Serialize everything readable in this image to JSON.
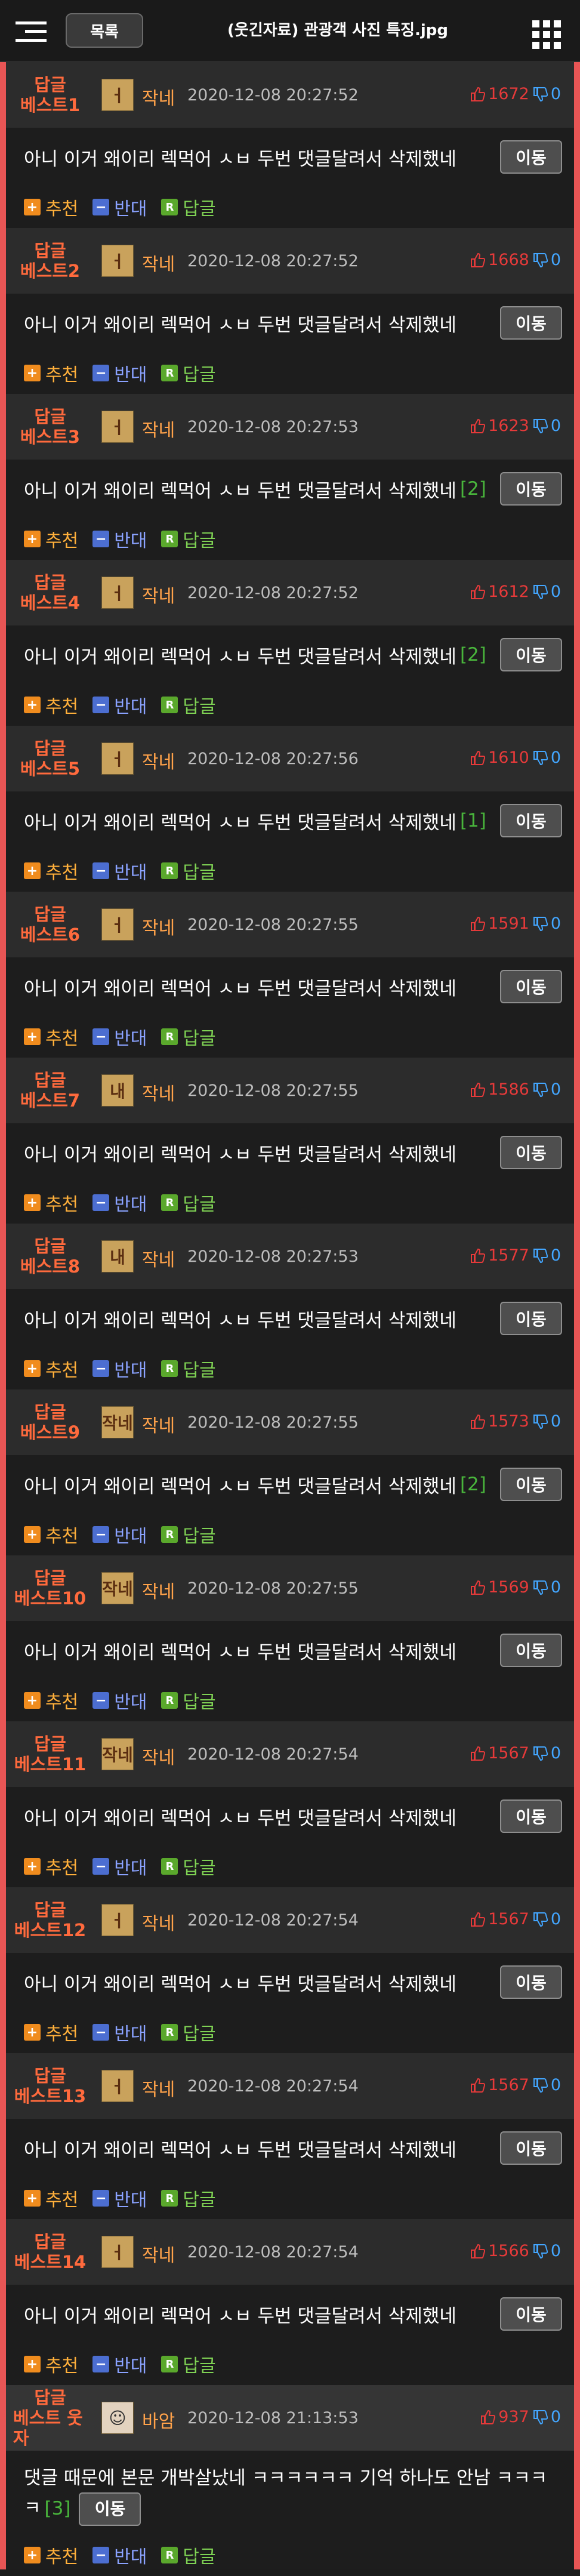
{
  "header": {
    "list_button": "목록",
    "title": "(웃긴자료) 관광객 사진 특징.jpg"
  },
  "comments": [
    {
      "rank_top": "답글",
      "rank_bottom": "베스트1",
      "avatar_text": "ㅓ",
      "nick": "작네",
      "date": "2020-12-08 20:27:52",
      "up": "1672",
      "down": "0",
      "body": "아니 이거 왜이리 렉먹어 ㅅㅂ 두번 댓글달려서 삭제했네",
      "count": "",
      "move": "이동",
      "recommend": "추천",
      "oppose": "반대",
      "reply": "답글"
    },
    {
      "rank_top": "답글",
      "rank_bottom": "베스트2",
      "avatar_text": "ㅓ",
      "nick": "작네",
      "date": "2020-12-08 20:27:52",
      "up": "1668",
      "down": "0",
      "body": "아니 이거 왜이리 렉먹어 ㅅㅂ 두번 댓글달려서 삭제했네",
      "count": "",
      "move": "이동",
      "recommend": "추천",
      "oppose": "반대",
      "reply": "답글"
    },
    {
      "rank_top": "답글",
      "rank_bottom": "베스트3",
      "avatar_text": "ㅓ",
      "nick": "작네",
      "date": "2020-12-08 20:27:53",
      "up": "1623",
      "down": "0",
      "body": "아니 이거 왜이리 렉먹어 ㅅㅂ 두번 댓글달려서 삭제했네",
      "count": "[2]",
      "move": "이동",
      "recommend": "추천",
      "oppose": "반대",
      "reply": "답글"
    },
    {
      "rank_top": "답글",
      "rank_bottom": "베스트4",
      "avatar_text": "ㅓ",
      "nick": "작네",
      "date": "2020-12-08 20:27:52",
      "up": "1612",
      "down": "0",
      "body": "아니 이거 왜이리 렉먹어 ㅅㅂ 두번 댓글달려서 삭제했네",
      "count": "[2]",
      "move": "이동",
      "recommend": "추천",
      "oppose": "반대",
      "reply": "답글"
    },
    {
      "rank_top": "답글",
      "rank_bottom": "베스트5",
      "avatar_text": "ㅓ",
      "nick": "작네",
      "date": "2020-12-08 20:27:56",
      "up": "1610",
      "down": "0",
      "body": "아니 이거 왜이리 렉먹어 ㅅㅂ 두번 댓글달려서 삭제했네",
      "count": "[1]",
      "move": "이동",
      "recommend": "추천",
      "oppose": "반대",
      "reply": "답글"
    },
    {
      "rank_top": "답글",
      "rank_bottom": "베스트6",
      "avatar_text": "ㅓ",
      "nick": "작네",
      "date": "2020-12-08 20:27:55",
      "up": "1591",
      "down": "0",
      "body": "아니 이거 왜이리 렉먹어 ㅅㅂ 두번 댓글달려서 삭제했네",
      "count": "",
      "move": "이동",
      "recommend": "추천",
      "oppose": "반대",
      "reply": "답글"
    },
    {
      "rank_top": "답글",
      "rank_bottom": "베스트7",
      "avatar_text": "내",
      "nick": "작네",
      "date": "2020-12-08 20:27:55",
      "up": "1586",
      "down": "0",
      "body": "아니 이거 왜이리 렉먹어 ㅅㅂ 두번 댓글달려서 삭제했네",
      "count": "",
      "move": "이동",
      "recommend": "추천",
      "oppose": "반대",
      "reply": "답글"
    },
    {
      "rank_top": "답글",
      "rank_bottom": "베스트8",
      "avatar_text": "내",
      "nick": "작네",
      "date": "2020-12-08 20:27:53",
      "up": "1577",
      "down": "0",
      "body": "아니 이거 왜이리 렉먹어 ㅅㅂ 두번 댓글달려서 삭제했네",
      "count": "",
      "move": "이동",
      "recommend": "추천",
      "oppose": "반대",
      "reply": "답글"
    },
    {
      "rank_top": "답글",
      "rank_bottom": "베스트9",
      "avatar_text": "작네",
      "nick": "작네",
      "date": "2020-12-08 20:27:55",
      "up": "1573",
      "down": "0",
      "body": "아니 이거 왜이리 렉먹어 ㅅㅂ 두번 댓글달려서 삭제했네",
      "count": "[2]",
      "move": "이동",
      "recommend": "추천",
      "oppose": "반대",
      "reply": "답글"
    },
    {
      "rank_top": "답글",
      "rank_bottom": "베스트10",
      "avatar_text": "작네",
      "nick": "작네",
      "date": "2020-12-08 20:27:55",
      "up": "1569",
      "down": "0",
      "body": "아니 이거 왜이리 렉먹어 ㅅㅂ 두번 댓글달려서 삭제했네",
      "count": "",
      "move": "이동",
      "recommend": "추천",
      "oppose": "반대",
      "reply": "답글"
    },
    {
      "rank_top": "답글",
      "rank_bottom": "베스트11",
      "avatar_text": "작네",
      "nick": "작네",
      "date": "2020-12-08 20:27:54",
      "up": "1567",
      "down": "0",
      "body": "아니 이거 왜이리 렉먹어 ㅅㅂ 두번 댓글달려서 삭제했네",
      "count": "",
      "move": "이동",
      "recommend": "추천",
      "oppose": "반대",
      "reply": "답글"
    },
    {
      "rank_top": "답글",
      "rank_bottom": "베스트12",
      "avatar_text": "ㅓ",
      "nick": "작네",
      "date": "2020-12-08 20:27:54",
      "up": "1567",
      "down": "0",
      "body": "아니 이거 왜이리 렉먹어 ㅅㅂ 두번 댓글달려서 삭제했네",
      "count": "",
      "move": "이동",
      "recommend": "추천",
      "oppose": "반대",
      "reply": "답글"
    },
    {
      "rank_top": "답글",
      "rank_bottom": "베스트13",
      "avatar_text": "ㅓ",
      "nick": "작네",
      "date": "2020-12-08 20:27:54",
      "up": "1567",
      "down": "0",
      "body": "아니 이거 왜이리 렉먹어 ㅅㅂ 두번 댓글달려서 삭제했네",
      "count": "",
      "move": "이동",
      "recommend": "추천",
      "oppose": "반대",
      "reply": "답글"
    },
    {
      "rank_top": "답글",
      "rank_bottom": "베스트14",
      "avatar_text": "ㅓ",
      "nick": "작네",
      "date": "2020-12-08 20:27:54",
      "up": "1566",
      "down": "0",
      "body": "아니 이거 왜이리 렉먹어 ㅅㅂ 두번 댓글달려서 삭제했네",
      "count": "",
      "move": "이동",
      "recommend": "추천",
      "oppose": "반대",
      "reply": "답글"
    },
    {
      "rank_top": "답글",
      "rank_bottom": "베스트 웃자",
      "avatar_text": "☺",
      "nick": "바암",
      "date": "2020-12-08 21:13:53",
      "up": "937",
      "down": "0",
      "body": "댓글 때문에 본문 개박살났네 ㅋㅋㅋㅋㅋㅋ 기억 하나도 안남 ㅋㅋㅋㅋ",
      "count": "[3]",
      "move": "이동",
      "recommend": "추천",
      "oppose": "반대",
      "reply": "답글"
    }
  ],
  "icons": {
    "menu": "menu-icon",
    "grid": "grid-icon",
    "thumbs_up": "thumbs-up-icon",
    "thumbs_down": "thumbs-down-icon",
    "recommend": "plus-icon",
    "oppose": "minus-icon",
    "reply": "reply-icon"
  },
  "colors": {
    "rank": "#ff6a3d",
    "nick": "#ffa24a",
    "upvote": "#e53a3a",
    "downvote": "#43a6ff",
    "count": "#49b53c",
    "frame": "#e85555"
  }
}
